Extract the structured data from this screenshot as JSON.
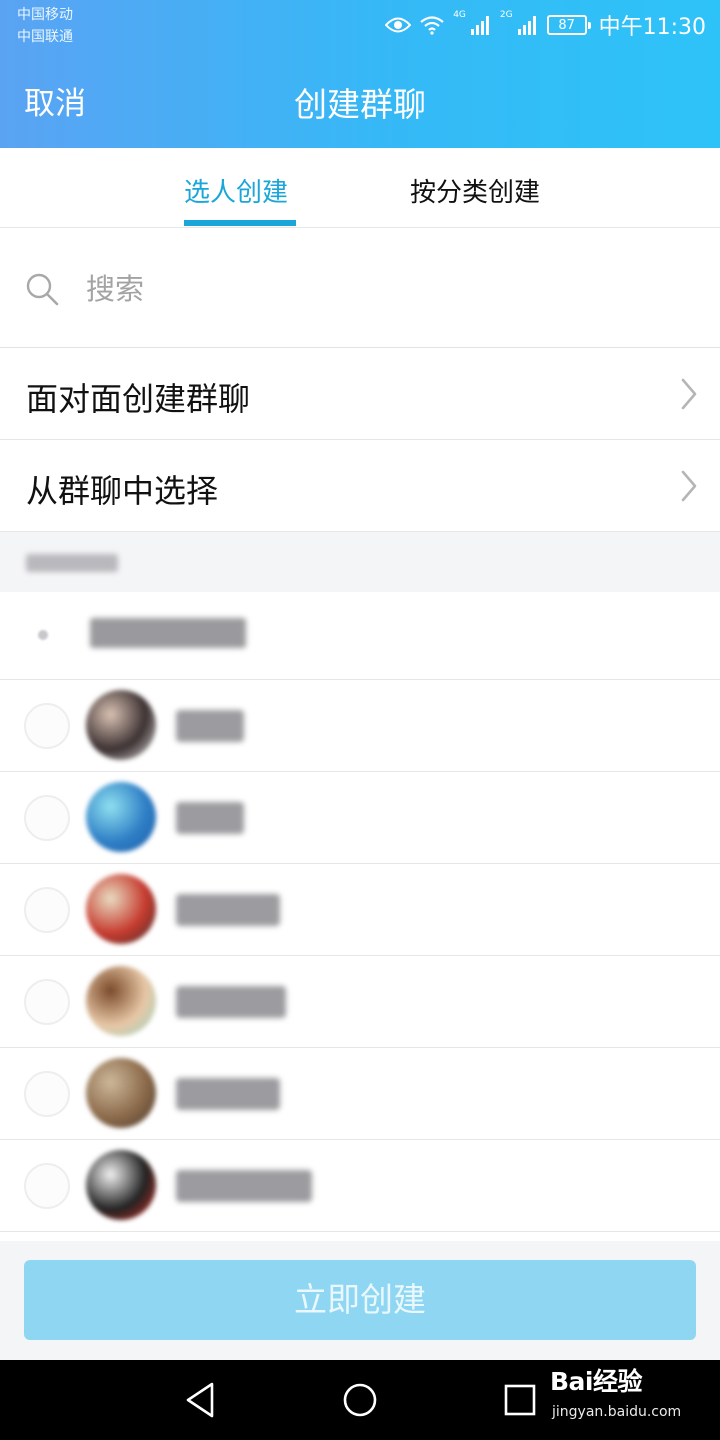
{
  "status_bar": {
    "carrier_1": "中国移动",
    "carrier_2": "中国联通",
    "network_1": "4G",
    "network_2": "2G",
    "battery": "87",
    "time": "中午11:30"
  },
  "nav": {
    "cancel_label": "取消",
    "title": "创建群聊"
  },
  "tabs": [
    {
      "label": "选人创建",
      "active": true
    },
    {
      "label": "按分类创建",
      "active": false
    }
  ],
  "search": {
    "placeholder": "搜索",
    "value": ""
  },
  "menu": [
    {
      "label": "面对面创建群聊"
    },
    {
      "label": "从群聊中选择"
    }
  ],
  "contacts": [
    {
      "avatar_colors": [
        "#3c3132",
        "#d9c2b3",
        "#e8e8e8"
      ]
    },
    {
      "avatar_colors": [
        "#2f7fc6",
        "#8fe0f0",
        "#1c5ea8"
      ]
    },
    {
      "avatar_colors": [
        "#c63a2e",
        "#e9dcc2",
        "#3a3330"
      ]
    },
    {
      "avatar_colors": [
        "#e7c7a6",
        "#7a4a2a",
        "#9ad6c3"
      ]
    },
    {
      "avatar_colors": [
        "#8b6a4a",
        "#cdb89a",
        "#4a3a2e"
      ]
    },
    {
      "avatar_colors": [
        "#222222",
        "#f1f1f1",
        "#d9342a"
      ]
    }
  ],
  "create_button": {
    "label": "立即创建",
    "enabled": false
  },
  "watermark": {
    "logo": "Bai经验",
    "url": "jingyan.baidu.com"
  },
  "colors": {
    "header_start": "#5aa3f3",
    "header_end": "#2ec3f8",
    "accent": "#1aa6d8",
    "button_disabled": "#8fd6f2"
  }
}
